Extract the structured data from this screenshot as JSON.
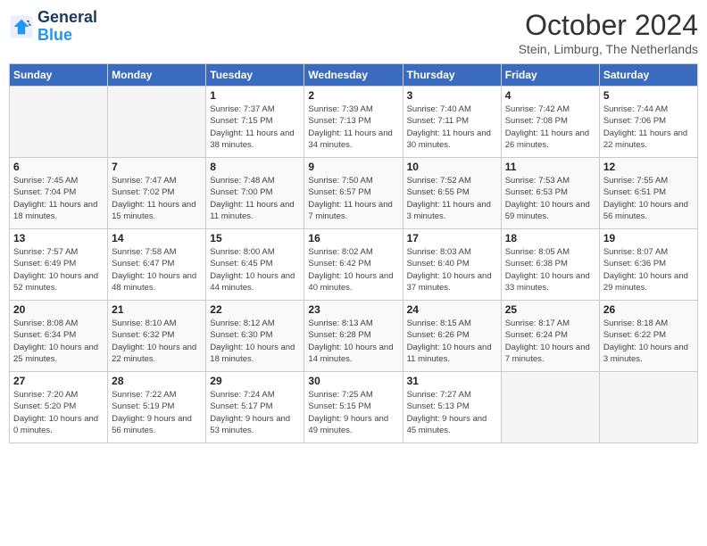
{
  "header": {
    "logo_line1": "General",
    "logo_line2": "Blue",
    "month_title": "October 2024",
    "subtitle": "Stein, Limburg, The Netherlands"
  },
  "days_of_week": [
    "Sunday",
    "Monday",
    "Tuesday",
    "Wednesday",
    "Thursday",
    "Friday",
    "Saturday"
  ],
  "weeks": [
    [
      {
        "day": "",
        "empty": true
      },
      {
        "day": "",
        "empty": true
      },
      {
        "day": "1",
        "sunrise": "Sunrise: 7:37 AM",
        "sunset": "Sunset: 7:15 PM",
        "daylight": "Daylight: 11 hours and 38 minutes."
      },
      {
        "day": "2",
        "sunrise": "Sunrise: 7:39 AM",
        "sunset": "Sunset: 7:13 PM",
        "daylight": "Daylight: 11 hours and 34 minutes."
      },
      {
        "day": "3",
        "sunrise": "Sunrise: 7:40 AM",
        "sunset": "Sunset: 7:11 PM",
        "daylight": "Daylight: 11 hours and 30 minutes."
      },
      {
        "day": "4",
        "sunrise": "Sunrise: 7:42 AM",
        "sunset": "Sunset: 7:08 PM",
        "daylight": "Daylight: 11 hours and 26 minutes."
      },
      {
        "day": "5",
        "sunrise": "Sunrise: 7:44 AM",
        "sunset": "Sunset: 7:06 PM",
        "daylight": "Daylight: 11 hours and 22 minutes."
      }
    ],
    [
      {
        "day": "6",
        "sunrise": "Sunrise: 7:45 AM",
        "sunset": "Sunset: 7:04 PM",
        "daylight": "Daylight: 11 hours and 18 minutes."
      },
      {
        "day": "7",
        "sunrise": "Sunrise: 7:47 AM",
        "sunset": "Sunset: 7:02 PM",
        "daylight": "Daylight: 11 hours and 15 minutes."
      },
      {
        "day": "8",
        "sunrise": "Sunrise: 7:48 AM",
        "sunset": "Sunset: 7:00 PM",
        "daylight": "Daylight: 11 hours and 11 minutes."
      },
      {
        "day": "9",
        "sunrise": "Sunrise: 7:50 AM",
        "sunset": "Sunset: 6:57 PM",
        "daylight": "Daylight: 11 hours and 7 minutes."
      },
      {
        "day": "10",
        "sunrise": "Sunrise: 7:52 AM",
        "sunset": "Sunset: 6:55 PM",
        "daylight": "Daylight: 11 hours and 3 minutes."
      },
      {
        "day": "11",
        "sunrise": "Sunrise: 7:53 AM",
        "sunset": "Sunset: 6:53 PM",
        "daylight": "Daylight: 10 hours and 59 minutes."
      },
      {
        "day": "12",
        "sunrise": "Sunrise: 7:55 AM",
        "sunset": "Sunset: 6:51 PM",
        "daylight": "Daylight: 10 hours and 56 minutes."
      }
    ],
    [
      {
        "day": "13",
        "sunrise": "Sunrise: 7:57 AM",
        "sunset": "Sunset: 6:49 PM",
        "daylight": "Daylight: 10 hours and 52 minutes."
      },
      {
        "day": "14",
        "sunrise": "Sunrise: 7:58 AM",
        "sunset": "Sunset: 6:47 PM",
        "daylight": "Daylight: 10 hours and 48 minutes."
      },
      {
        "day": "15",
        "sunrise": "Sunrise: 8:00 AM",
        "sunset": "Sunset: 6:45 PM",
        "daylight": "Daylight: 10 hours and 44 minutes."
      },
      {
        "day": "16",
        "sunrise": "Sunrise: 8:02 AM",
        "sunset": "Sunset: 6:42 PM",
        "daylight": "Daylight: 10 hours and 40 minutes."
      },
      {
        "day": "17",
        "sunrise": "Sunrise: 8:03 AM",
        "sunset": "Sunset: 6:40 PM",
        "daylight": "Daylight: 10 hours and 37 minutes."
      },
      {
        "day": "18",
        "sunrise": "Sunrise: 8:05 AM",
        "sunset": "Sunset: 6:38 PM",
        "daylight": "Daylight: 10 hours and 33 minutes."
      },
      {
        "day": "19",
        "sunrise": "Sunrise: 8:07 AM",
        "sunset": "Sunset: 6:36 PM",
        "daylight": "Daylight: 10 hours and 29 minutes."
      }
    ],
    [
      {
        "day": "20",
        "sunrise": "Sunrise: 8:08 AM",
        "sunset": "Sunset: 6:34 PM",
        "daylight": "Daylight: 10 hours and 25 minutes."
      },
      {
        "day": "21",
        "sunrise": "Sunrise: 8:10 AM",
        "sunset": "Sunset: 6:32 PM",
        "daylight": "Daylight: 10 hours and 22 minutes."
      },
      {
        "day": "22",
        "sunrise": "Sunrise: 8:12 AM",
        "sunset": "Sunset: 6:30 PM",
        "daylight": "Daylight: 10 hours and 18 minutes."
      },
      {
        "day": "23",
        "sunrise": "Sunrise: 8:13 AM",
        "sunset": "Sunset: 6:28 PM",
        "daylight": "Daylight: 10 hours and 14 minutes."
      },
      {
        "day": "24",
        "sunrise": "Sunrise: 8:15 AM",
        "sunset": "Sunset: 6:26 PM",
        "daylight": "Daylight: 10 hours and 11 minutes."
      },
      {
        "day": "25",
        "sunrise": "Sunrise: 8:17 AM",
        "sunset": "Sunset: 6:24 PM",
        "daylight": "Daylight: 10 hours and 7 minutes."
      },
      {
        "day": "26",
        "sunrise": "Sunrise: 8:18 AM",
        "sunset": "Sunset: 6:22 PM",
        "daylight": "Daylight: 10 hours and 3 minutes."
      }
    ],
    [
      {
        "day": "27",
        "sunrise": "Sunrise: 7:20 AM",
        "sunset": "Sunset: 5:20 PM",
        "daylight": "Daylight: 10 hours and 0 minutes."
      },
      {
        "day": "28",
        "sunrise": "Sunrise: 7:22 AM",
        "sunset": "Sunset: 5:19 PM",
        "daylight": "Daylight: 9 hours and 56 minutes."
      },
      {
        "day": "29",
        "sunrise": "Sunrise: 7:24 AM",
        "sunset": "Sunset: 5:17 PM",
        "daylight": "Daylight: 9 hours and 53 minutes."
      },
      {
        "day": "30",
        "sunrise": "Sunrise: 7:25 AM",
        "sunset": "Sunset: 5:15 PM",
        "daylight": "Daylight: 9 hours and 49 minutes."
      },
      {
        "day": "31",
        "sunrise": "Sunrise: 7:27 AM",
        "sunset": "Sunset: 5:13 PM",
        "daylight": "Daylight: 9 hours and 45 minutes."
      },
      {
        "day": "",
        "empty": true
      },
      {
        "day": "",
        "empty": true
      }
    ]
  ]
}
